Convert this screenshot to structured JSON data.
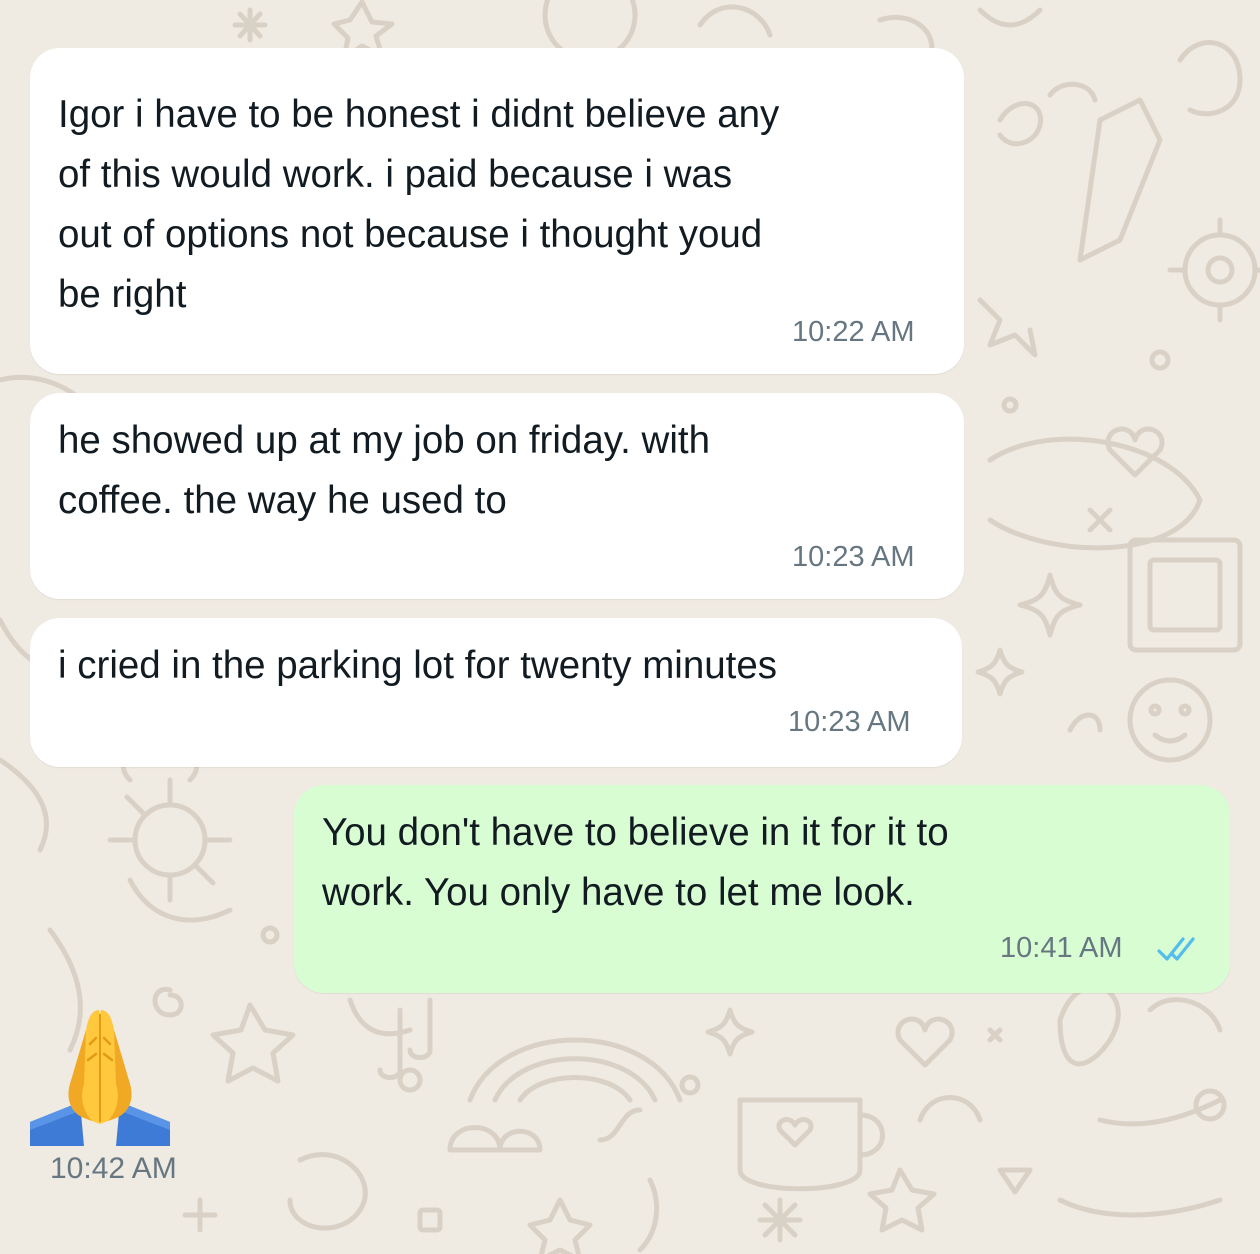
{
  "colors": {
    "wallpaper": "#EFEAE2",
    "incoming_bubble": "#FFFFFF",
    "outgoing_bubble": "#D9FDD3",
    "timestamp": "#667781",
    "read_ticks": "#53BDEB"
  },
  "messages": [
    {
      "direction": "incoming",
      "text": "Igor i have to be honest i didnt believe any\nof this would work. i paid because i was\nout of options not because i thought youd\nbe right",
      "time": "10:22 AM"
    },
    {
      "direction": "incoming",
      "text": "he showed up at my job on friday. with\ncoffee. the way he used to",
      "time": "10:23 AM"
    },
    {
      "direction": "incoming",
      "text": "i cried in the parking lot for twenty minutes",
      "time": "10:23 AM"
    },
    {
      "direction": "outgoing",
      "text": "You don't have to believe in it for it to\nwork. You only have to let me look.",
      "time": "10:41 AM",
      "status_icon": "double-check-read-icon"
    },
    {
      "direction": "incoming",
      "emoji": "folded-hands-emoji",
      "time": "10:42 AM"
    }
  ]
}
